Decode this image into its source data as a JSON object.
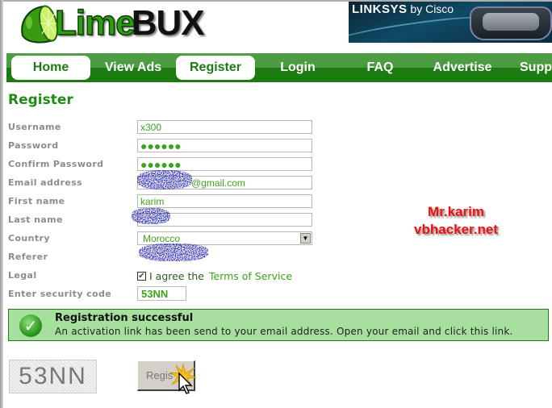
{
  "logo": {
    "part1": "Lime",
    "part2": "BUX"
  },
  "ad": {
    "brand": "LINKSYS",
    "tagline": "by Cisco"
  },
  "nav": {
    "items": [
      {
        "label": "Home",
        "active": true
      },
      {
        "label": "View Ads",
        "active": false
      },
      {
        "label": "Register",
        "active": true
      },
      {
        "label": "Login",
        "active": false
      },
      {
        "label": "FAQ",
        "active": false
      },
      {
        "label": "Advertise",
        "active": false
      },
      {
        "label": "Supp",
        "active": false
      }
    ]
  },
  "page": {
    "title": "Register"
  },
  "form": {
    "labels": {
      "username": "Username",
      "password": "Password",
      "confirm_password": "Confirm Password",
      "email": "Email address",
      "first_name": "First name",
      "last_name": "Last name",
      "country": "Country",
      "referer": "Referer",
      "legal": "Legal",
      "security_code": "Enter security code"
    },
    "values": {
      "username": "x300",
      "password": "●●●●●●",
      "confirm_password": "●●●●●●",
      "email_visible_part": "@gmail.com",
      "first_name": "karim",
      "country": "Morocco",
      "security_code": "53NN"
    },
    "legal": {
      "checked": true,
      "text": "I agree the",
      "link": "Terms of Service"
    }
  },
  "watermark": {
    "line1": "Mr.karim",
    "line2": "vbhacker.net"
  },
  "alert": {
    "title": "Registration successful",
    "message": "An activation link has been send to your email address. Open your email and click this link."
  },
  "captcha": {
    "text": "53NN"
  },
  "submit": {
    "label": "Regis"
  },
  "colors": {
    "brand_green": "#1f7a13",
    "nav_green": "#1c7c12",
    "success_bg": "#a6df9e",
    "field_text": "#3aa51a",
    "watermark_red": "#ee1010"
  }
}
